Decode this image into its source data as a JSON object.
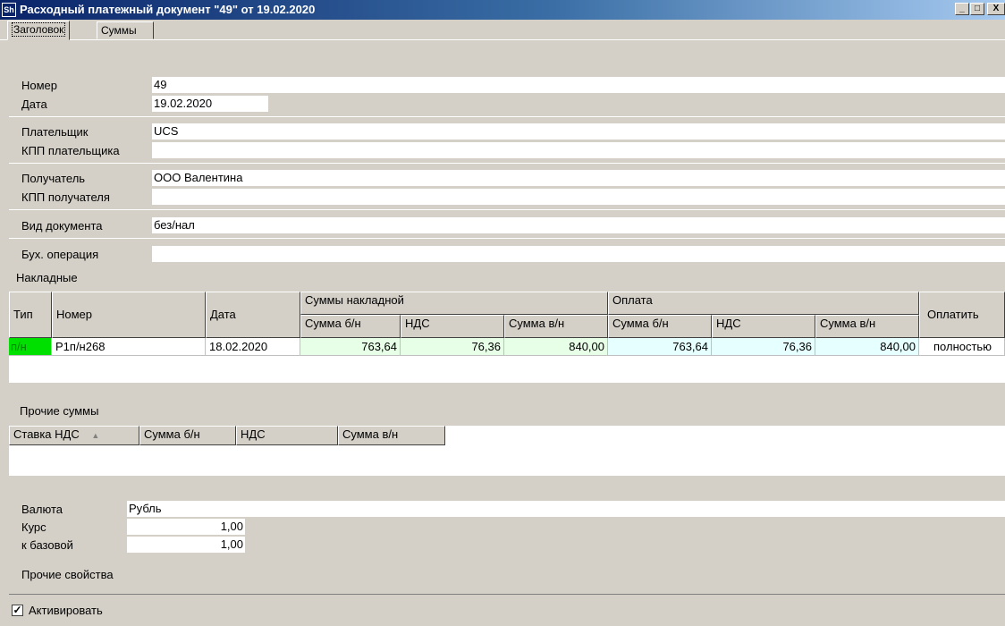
{
  "window": {
    "title": "Расходный платежный документ \"49\" от 19.02.2020",
    "app_icon": "Sh",
    "minimize_glyph": "_",
    "maximize_glyph": "□",
    "close_glyph": "X"
  },
  "tabs": [
    {
      "label": "Заголовок",
      "active": true
    },
    {
      "label": "Суммы",
      "active": false
    }
  ],
  "form": {
    "number": {
      "label": "Номер",
      "value": "49"
    },
    "date": {
      "label": "Дата",
      "value": "19.02.2020"
    },
    "payer": {
      "label": "Плательщик",
      "value": "UCS"
    },
    "payer_kpp": {
      "label": "КПП плательщика",
      "value": ""
    },
    "recipient": {
      "label": "Получатель",
      "value": "ООО Валентина"
    },
    "recipient_kpp": {
      "label": "КПП получателя",
      "value": ""
    },
    "doc_type": {
      "label": "Вид документа",
      "value": "без/нал"
    },
    "operation": {
      "label": "Бух. операция",
      "value": ""
    }
  },
  "invoices": {
    "section_label": "Накладные",
    "headers": {
      "type": "Тип",
      "number": "Номер",
      "date": "Дата",
      "invoice_group": "Суммы накладной",
      "payment_group": "Оплата",
      "sum_no_vat": "Сумма б/н",
      "vat": "НДС",
      "sum_vat": "Сумма в/н",
      "pay": "Оплатить"
    },
    "rows": [
      {
        "type": "п/н",
        "number": "Р1п/н268",
        "date": "18.02.2020",
        "inv_sum_no_vat": "763,64",
        "inv_vat": "76,36",
        "inv_sum_vat": "840,00",
        "pay_sum_no_vat": "763,64",
        "pay_vat": "76,36",
        "pay_sum_vat": "840,00",
        "pay": "полностью"
      }
    ]
  },
  "other_sums": {
    "section_label": "Прочие суммы",
    "headers": {
      "vat_rate": "Ставка НДС",
      "sort_glyph": "▲",
      "sum_no_vat": "Сумма б/н",
      "vat": "НДС",
      "sum_vat": "Сумма в/н"
    }
  },
  "currency": {
    "currency_label": "Валюта",
    "currency_value": "Рубль",
    "rate_label": "Курс",
    "rate_value": "1,00",
    "base_label": "к базовой",
    "base_value": "1,00"
  },
  "other_props_label": "Прочие свойства",
  "activate": {
    "label": "Активировать",
    "checked": true,
    "check_glyph": "✓"
  },
  "colors": {
    "titlebar_start": "#0a246a",
    "type_cell": "#00e000",
    "invoice_sum_bg": "#e6ffe6",
    "payment_sum_bg": "#e6ffff"
  }
}
